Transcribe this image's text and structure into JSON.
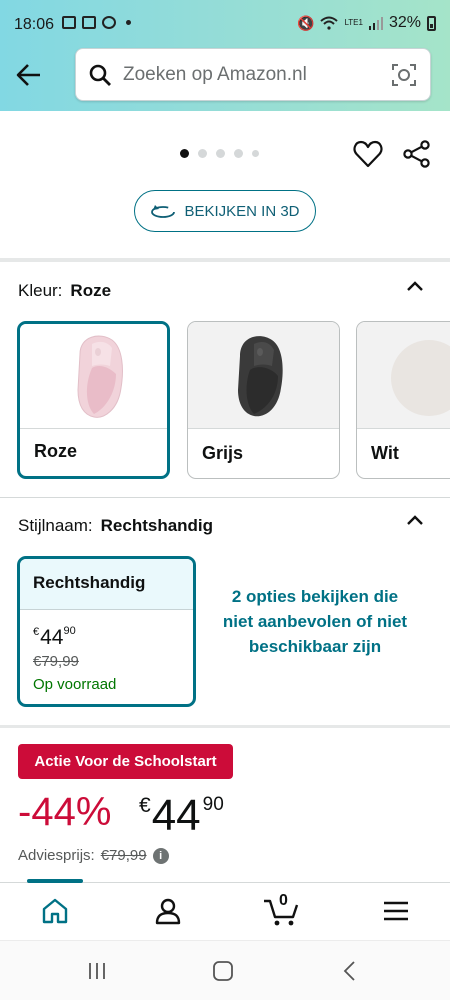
{
  "status_bar": {
    "time": "18:06",
    "battery": "32%",
    "network": "LTE1"
  },
  "search": {
    "placeholder": "Zoeken op Amazon.nl"
  },
  "gallery": {
    "dot_count": 5,
    "active_index": 0
  },
  "view_3d": {
    "label": "BEKIJKEN IN 3D"
  },
  "color": {
    "label": "Kleur:",
    "selected": "Roze",
    "options": [
      {
        "name": "Roze",
        "swatch_color": "#f3d7dd"
      },
      {
        "name": "Grijs",
        "swatch_color": "#3a3a3a"
      },
      {
        "name": "Wit",
        "swatch_color": "#ebe6e2"
      }
    ]
  },
  "style": {
    "label": "Stijlnaam:",
    "selected": "Rechtshandig",
    "card": {
      "title": "Rechtshandig",
      "currency": "€",
      "price_whole": "44",
      "price_fraction": "90",
      "list_price": "€79,99",
      "availability": "Op voorraad"
    },
    "more_options": "2 opties bekijken die niet aanbevolen of niet beschikbaar zijn"
  },
  "deal": {
    "badge": "Actie Voor de Schoolstart",
    "discount": "-44%",
    "currency": "€",
    "price_whole": "44",
    "price_fraction": "90",
    "list_label": "Adviesprijs:",
    "list_price": "€79,99"
  },
  "tabbar": {
    "cart_count": "0",
    "tabs": [
      "home-icon",
      "account-icon",
      "cart-icon",
      "menu-icon"
    ]
  },
  "colors": {
    "accent": "#007185",
    "deal_red": "#cc0c39",
    "stock_green": "#007600"
  }
}
